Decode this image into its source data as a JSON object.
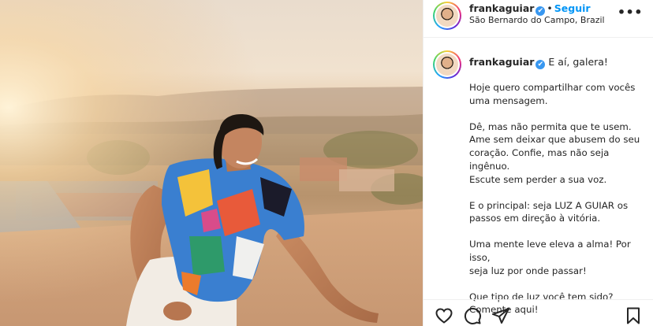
{
  "post": {
    "username": "frankaguiar",
    "verified_mark": "✔",
    "separator": "•",
    "follow_label": "Seguir",
    "location": "São Bernardo do Campo, Brazil",
    "more_label": "•••"
  },
  "caption": {
    "username": "frankaguiar",
    "first_line": "E aí, galera!",
    "paragraphs": [
      "Hoje quero compartilhar com vocês\numa mensagem.",
      "Dê, mas não permita que te usem.\nAme sem deixar que abusem do seu\ncoração. Confie, mas não seja ingênuo.\nEscute sem perder a sua voz.",
      "E o principal: seja LUZ A GUIAR os\npassos em direção à vitória.",
      "Uma mente leve eleva a alma! Por isso,\nseja luz por onde passar!",
      "Que tipo de luz você tem sido?\nComente aqui!"
    ]
  },
  "icons": {
    "like": "heart-icon",
    "comment": "comment-icon",
    "share": "paper-plane-icon",
    "save": "bookmark-icon"
  },
  "colors": {
    "link_blue": "#0095f6",
    "verified_blue": "#3897f0",
    "text": "#262626",
    "divider": "#efefef"
  }
}
